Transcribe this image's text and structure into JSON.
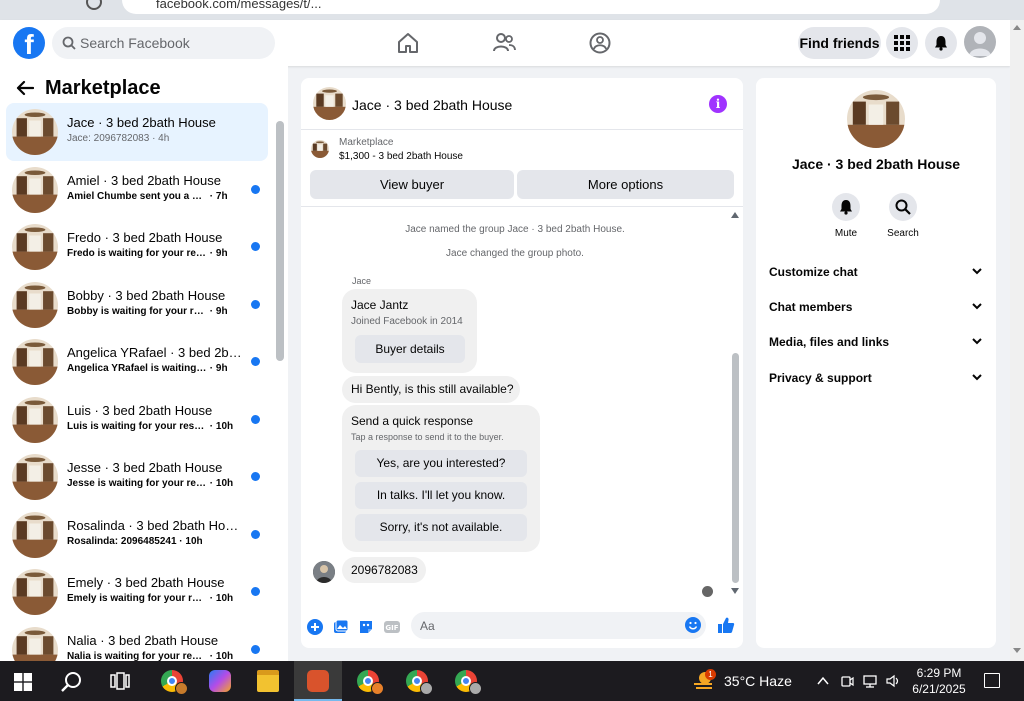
{
  "browser": {
    "url": "facebook.com/messages/t/..."
  },
  "header": {
    "search_placeholder": "Search Facebook",
    "find_friends": "Find friends"
  },
  "left": {
    "title": "Marketplace",
    "conversations": [
      {
        "name": "Jace · 3 bed 2bath House",
        "preview": "Jace: 2096782083",
        "time": "· 4h",
        "active": true,
        "unread": false
      },
      {
        "name": "Amiel · 3 bed 2bath House",
        "preview": "Amiel Chumbe sent you a mess...",
        "time": "· 7h",
        "active": false,
        "unread": true
      },
      {
        "name": "Fredo · 3 bed 2bath House",
        "preview": "Fredo is waiting for your respo...",
        "time": "· 9h",
        "active": false,
        "unread": true
      },
      {
        "name": "Bobby · 3 bed 2bath House",
        "preview": "Bobby is waiting for your respo...",
        "time": "· 9h",
        "active": false,
        "unread": true
      },
      {
        "name": "Angelica YRafael · 3 bed 2bat...",
        "preview": "Angelica YRafael is waiting for ...",
        "time": "· 9h",
        "active": false,
        "unread": true
      },
      {
        "name": "Luis · 3 bed 2bath House",
        "preview": "Luis is waiting for your respon...",
        "time": "· 10h",
        "active": false,
        "unread": true
      },
      {
        "name": "Jesse · 3 bed 2bath House",
        "preview": "Jesse is waiting for your respo...",
        "time": "· 10h",
        "active": false,
        "unread": true
      },
      {
        "name": "Rosalinda · 3 bed 2bath House",
        "preview": "Rosalinda: 2096485241",
        "time": "· 10h",
        "active": false,
        "unread": true
      },
      {
        "name": "Emely · 3 bed 2bath House",
        "preview": "Emely is waiting for your resp...",
        "time": "· 10h",
        "active": false,
        "unread": true
      },
      {
        "name": "Nalia · 3 bed 2bath House",
        "preview": "Nalia is waiting for your respo...",
        "time": "· 10h",
        "active": false,
        "unread": true
      }
    ]
  },
  "chat": {
    "title": "Jace · 3 bed 2bath House",
    "listing_source": "Marketplace",
    "listing_price": "$1,300 - 3 bed 2bath House",
    "view_buyer": "View buyer",
    "more_options": "More options",
    "system_messages": [
      "Jace named the group Jace · 3 bed 2bath House.",
      "Jace changed the group photo."
    ],
    "sender": "Jace",
    "profile_name": "Jace Jantz",
    "profile_joined": "Joined Facebook in 2014",
    "buyer_details": "Buyer details",
    "message_hi": "Hi Bently, is this still available?",
    "quick_title": "Send a quick response",
    "quick_subtitle": "Tap a response to send it to the buyer.",
    "quick_responses": [
      "Yes, are you interested?",
      "In talks. I'll let you know.",
      "Sorry, it's not available."
    ],
    "message_number": "2096782083",
    "composer_placeholder": "Aa"
  },
  "info": {
    "title": "Jace · 3 bed 2bath House",
    "mute": "Mute",
    "search": "Search",
    "sections": [
      "Customize chat",
      "Chat members",
      "Media, files and links",
      "Privacy & support"
    ]
  },
  "taskbar": {
    "weather": "35°C  Haze",
    "weather_badge": "1",
    "time": "6:29 PM",
    "date": "6/21/2025"
  },
  "colors": {
    "fb_blue": "#1877f2",
    "active_row": "#e7f3ff",
    "info_purple": "#a033ff"
  }
}
